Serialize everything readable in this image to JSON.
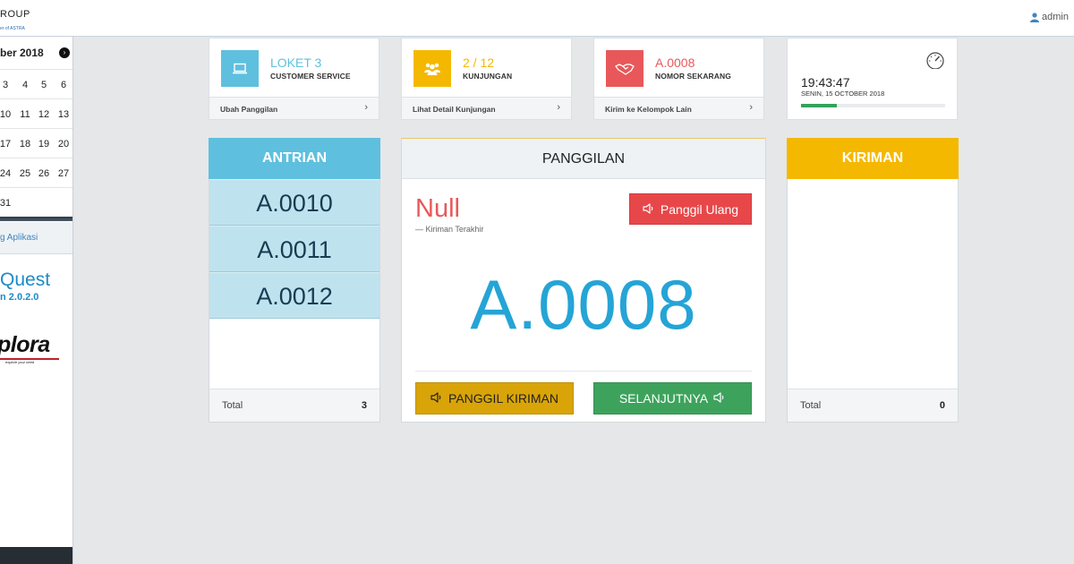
{
  "header": {
    "brand": "ROUP",
    "brand_sub": "er of ASTRA",
    "user": "admin"
  },
  "sidebar": {
    "calendar": {
      "month": "ber 2018",
      "rows": [
        [
          "3",
          "4",
          "5",
          "6"
        ],
        [
          "10",
          "11",
          "12",
          "13"
        ],
        [
          "17",
          "18",
          "19",
          "20"
        ],
        [
          "24",
          "25",
          "26",
          "27"
        ],
        [
          "31"
        ]
      ]
    },
    "link": "g Aplikasi",
    "app_name": "Quest",
    "version": "n 2.0.2.0",
    "logo": "plora",
    "logo_tagline": "explore your need"
  },
  "cards": {
    "counter": {
      "value": "LOKET 3",
      "label": "CUSTOMER SERVICE",
      "footer": "Ubah Panggilan",
      "color": "#5ec0de"
    },
    "visits": {
      "value": "2 / 12",
      "label": "KUNJUNGAN",
      "footer": "Lihat Detail Kunjungan",
      "color": "#f5b800"
    },
    "current": {
      "value": "A.0008",
      "label": "NOMOR SEKARANG",
      "footer": "Kirim ke Kelompok Lain",
      "color": "#e8585a"
    },
    "clock": {
      "time": "19:43:47",
      "date": "SENIN, 15 OCTOBER 2018",
      "progress": 0.25
    }
  },
  "queue": {
    "title": "ANTRIAN",
    "items": [
      "A.0010",
      "A.0011",
      "A.0012"
    ],
    "total_label": "Total",
    "total": "3",
    "header_color": "#5ec0de"
  },
  "call": {
    "title": "PANGGILAN",
    "last_sent": "Null",
    "last_sent_caption": "— Kiriman Terakhir",
    "recall_label": "Panggil Ulang",
    "current_number": "A.0008",
    "send_label": "PANGGIL KIRIMAN",
    "next_label": "SELANJUTNYA"
  },
  "sent": {
    "title": "KIRIMAN",
    "total_label": "Total",
    "total": "0",
    "header_color": "#f5b800"
  }
}
